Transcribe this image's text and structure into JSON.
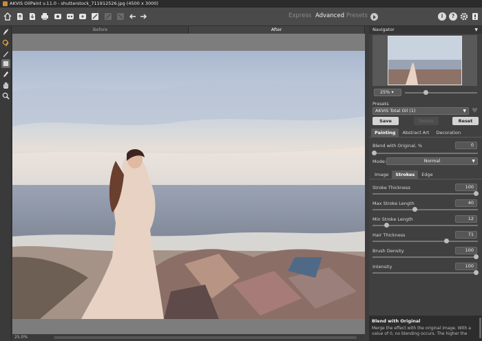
{
  "window": {
    "title": "AKVIS OilPaint v.11.0 - shutterstock_711912526.jpg (4500 x 3000)"
  },
  "toolbar": {
    "left_icons": [
      "home-icon",
      "open-file-icon",
      "save-file-icon",
      "print-icon",
      "batch-icon",
      "share-icon",
      "plugin-icon",
      "settings-icon",
      "crop-icon",
      "crop-icon",
      "undo-icon",
      "redo-icon"
    ],
    "modes": [
      "Express",
      "Advanced",
      "Presets"
    ],
    "active_mode": "Advanced"
  },
  "tools": [
    "brush-icon",
    "history-brush-icon",
    "stroke-icon",
    "eraser-icon",
    "pencil-icon",
    "hand-icon",
    "zoom-icon"
  ],
  "view_tabs": {
    "before": "Before",
    "after": "After"
  },
  "status": {
    "zoom": "25.0%"
  },
  "navigator": {
    "title": "Navigator",
    "zoom": "25%"
  },
  "presets": {
    "title": "Presets",
    "selected": "AKVIS Total Oil (1)",
    "save": "Save",
    "delete": "Delete",
    "reset": "Reset"
  },
  "main_tabs": [
    "Painting",
    "Abstract Art",
    "Decoration"
  ],
  "blend": {
    "label": "Blend with Original, %",
    "value": "0"
  },
  "mode": {
    "label": "Mode:",
    "value": "Normal"
  },
  "sub_tabs": [
    "Image",
    "Strokes",
    "Edge"
  ],
  "params": [
    {
      "label": "Stroke Thickness",
      "value": "100",
      "level": 1.0
    },
    {
      "label": "Max Stroke Length",
      "value": "40",
      "level": 0.4
    },
    {
      "label": "Min Stroke Length",
      "value": "12",
      "level": 0.12
    },
    {
      "label": "Hair Thickness",
      "value": "71",
      "level": 0.71
    },
    {
      "label": "Brush Density",
      "value": "100",
      "level": 1.0
    },
    {
      "label": "Intensity",
      "value": "100",
      "level": 1.0
    }
  ],
  "help": {
    "title": "Blend with Original",
    "text": "Merge the effect with the original image. With a value of 0, no blending occurs. The higher the"
  },
  "colors": {
    "toolbar": "#4a4a4a",
    "panel": "#404040",
    "active_tab": "#5a5a5a",
    "button": "#d4d4d4"
  }
}
